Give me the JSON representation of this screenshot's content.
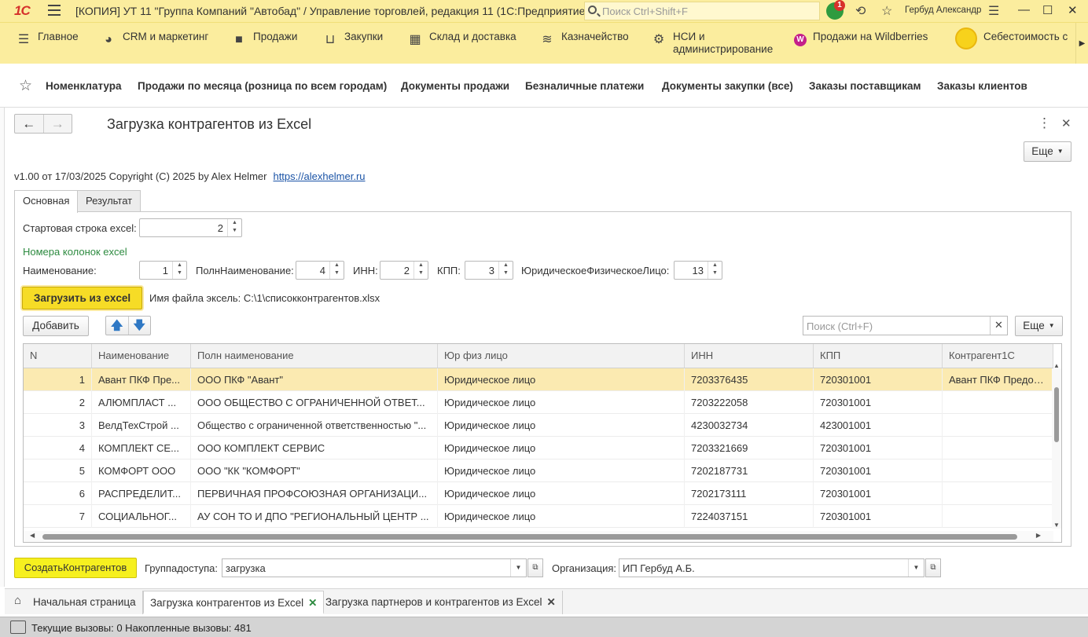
{
  "titlebar": {
    "logo": "1С",
    "title": "[КОПИЯ] УТ 11 \"Группа Компаний \"Автобад\" / Управление торговлей, редакция 11  (1С:Предприятие)",
    "search_placeholder": "Поиск Ctrl+Shift+F",
    "notifications_count": "1",
    "user": "Гербуд Александр"
  },
  "mainmenu": {
    "items": [
      {
        "label": "Главное",
        "icon": "menu-icon"
      },
      {
        "label": "CRM и маркетинг",
        "icon": "pie-chart-icon"
      },
      {
        "label": "Продажи",
        "icon": "bag-icon"
      },
      {
        "label": "Закупки",
        "icon": "cart-icon"
      },
      {
        "label": "Склад и доставка",
        "icon": "grid-icon"
      },
      {
        "label": "Казначейство",
        "icon": "coins-icon"
      },
      {
        "label": "НСИ и администрирование",
        "icon": "gear-icon"
      },
      {
        "label": "Продажи на Wildberries",
        "icon": "wildberries-icon"
      },
      {
        "label": "Себестоимость с",
        "icon": "sun-icon"
      }
    ]
  },
  "favorites": [
    "Номенклатура",
    "Продажи по месяца (розница по всем городам)",
    "Документы продажи",
    "Безналичные платежи",
    "Документы закупки (все)",
    "Заказы поставщикам",
    "Заказы клиентов"
  ],
  "form": {
    "title": "Загрузка контрагентов из Excel",
    "more_label": "Еще",
    "version": "v1.00 от 17/03/2025 Copyright (C) 2025  by Alex Helmer",
    "link": "https://alexhelmer.ru",
    "tabs": [
      "Основная",
      "Результат"
    ],
    "start_row_label": "Стартовая строка excel:",
    "start_row_value": "2",
    "columns_caption": "Номера колонок excel",
    "col_name_label": "Наименование:",
    "col_name_value": "1",
    "col_fullname_label": "ПолнНаименование:",
    "col_fullname_value": "4",
    "col_inn_label": "ИНН:",
    "col_inn_value": "2",
    "col_kpp_label": "КПП:",
    "col_kpp_value": "3",
    "col_legal_label": "ЮридическоеФизическоеЛицо:",
    "col_legal_value": "13",
    "load_button": "Загрузить из excel",
    "file_label": "Имя файла эксель:  C:\\1\\списокконтрагентов.xlsx",
    "add_button": "Добавить",
    "search_placeholder": "Поиск (Ctrl+F)",
    "table_more": "Еще",
    "create_button": "СоздатьКонтрагентов",
    "access_group_label": "Группадоступа:",
    "access_group_value": "загрузка",
    "org_label": "Организация:",
    "org_value": "ИП Гербуд А.Б."
  },
  "table": {
    "headers": [
      "N",
      "Наименование",
      "Полн наименование",
      "Юр физ лицо",
      "ИНН",
      "КПП",
      "Контрагент1С"
    ],
    "rows": [
      [
        "1",
        "Авант ПКФ Пре...",
        "ООО ПКФ \"Авант\"",
        "Юридическое лицо",
        "7203376435",
        "720301001",
        "Авант ПКФ Предопла"
      ],
      [
        "2",
        "АЛЮМПЛАСТ ...",
        "ООО ОБЩЕСТВО С ОГРАНИЧЕННОЙ ОТВЕТ...",
        "Юридическое лицо",
        "7203222058",
        "720301001",
        ""
      ],
      [
        "3",
        "ВелдТехСтрой ...",
        "Общество с ограниченной ответственностью \"...",
        "Юридическое лицо",
        "4230032734",
        "423001001",
        ""
      ],
      [
        "4",
        "КОМПЛЕКТ СЕ...",
        "ООО КОМПЛЕКТ СЕРВИС",
        "Юридическое лицо",
        "7203321669",
        "720301001",
        ""
      ],
      [
        "5",
        "КОМФОРТ ООО",
        "ООО \"КК \"КОМФОРТ\"",
        "Юридическое лицо",
        "7202187731",
        "720301001",
        ""
      ],
      [
        "6",
        "РАСПРЕДЕЛИТ...",
        "ПЕРВИЧНАЯ ПРОФСОЮЗНАЯ ОРГАНИЗАЦИ...",
        "Юридическое лицо",
        "7202173111",
        "720301001",
        ""
      ],
      [
        "7",
        "СОЦИАЛЬНОГ...",
        "АУ СОН ТО И ДПО \"РЕГИОНАЛЬНЫЙ ЦЕНТР ...",
        "Юридическое лицо",
        "7224037151",
        "720301001",
        ""
      ]
    ],
    "selected_row": 0
  },
  "wintabs": {
    "home": "Начальная страница",
    "tabs": [
      "Загрузка контрагентов из Excel",
      "Загрузка партнеров и контрагентов из Excel"
    ]
  },
  "status": {
    "text": "Текущие вызовы: 0    Накопленные вызовы: 481"
  },
  "colors": {
    "accent_yellow": "#fbed9e",
    "button_yellow": "#f6dc26",
    "selected_row": "#fbeab1",
    "green_text": "#2c8a3f"
  }
}
